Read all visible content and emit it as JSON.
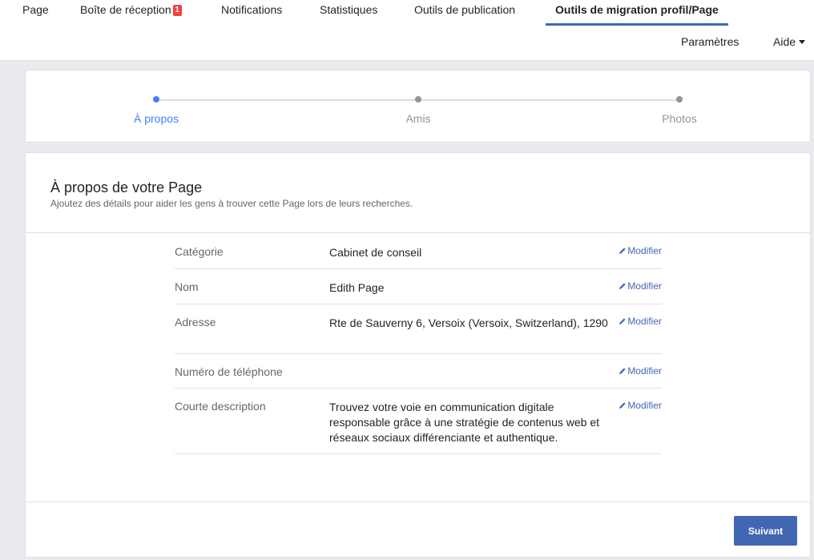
{
  "nav": {
    "tabs": [
      {
        "label": "Page"
      },
      {
        "label": "Boîte de réception",
        "badge": "1"
      },
      {
        "label": "Notifications"
      },
      {
        "label": "Statistiques"
      },
      {
        "label": "Outils de publication"
      },
      {
        "label": "Outils de migration profil/Page",
        "active": true
      }
    ],
    "settings_label": "Paramètres",
    "help_label": "Aide"
  },
  "steps": [
    {
      "label": "À propos",
      "active": true
    },
    {
      "label": "Amis",
      "active": false
    },
    {
      "label": "Photos",
      "active": false
    }
  ],
  "about": {
    "title": "À propos de votre Page",
    "subtitle": "Ajoutez des détails pour aider les gens à trouver cette Page lors de leurs recherches.",
    "edit_label": "Modifier",
    "rows": [
      {
        "label": "Catégorie",
        "value": "Cabinet de conseil"
      },
      {
        "label": "Nom",
        "value": "Edith Page"
      },
      {
        "label": "Adresse",
        "value": "Rte de Sauverny 6, Versoix (Versoix, Switzerland), 1290"
      },
      {
        "label": "Numéro de téléphone",
        "value": ""
      },
      {
        "label": "Courte description",
        "value": "Trouvez votre voie en communication digitale responsable grâce à une stratégie de contenus web et réseaux sociaux différenciante et authentique."
      }
    ]
  },
  "footer": {
    "next_label": "Suivant"
  },
  "colors": {
    "accent": "#4267b2",
    "step_active": "#4080ff",
    "badge": "#fa3e3e"
  }
}
